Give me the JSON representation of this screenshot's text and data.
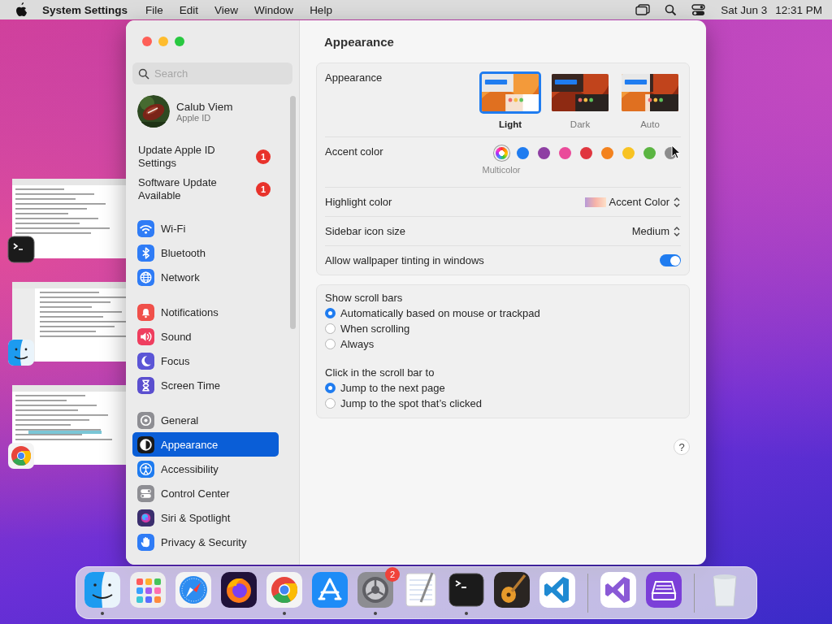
{
  "menu_bar": {
    "app_name": "System Settings",
    "menus": [
      "File",
      "Edit",
      "View",
      "Window",
      "Help"
    ],
    "date": "Sat Jun 3",
    "time": "12:31 PM"
  },
  "sidebar": {
    "search": {
      "placeholder": "Search"
    },
    "account": {
      "name": "Calub Viem",
      "subtitle": "Apple ID"
    },
    "alerts": [
      {
        "label": "Update Apple ID Settings",
        "badge": "1"
      },
      {
        "label": "Software Update Available",
        "badge": "1"
      }
    ],
    "groups": [
      {
        "items": [
          {
            "label": "Wi-Fi",
            "selected": false,
            "color": "#2f7cf6"
          },
          {
            "label": "Bluetooth",
            "selected": false,
            "color": "#2f7cf6"
          },
          {
            "label": "Network",
            "selected": false,
            "color": "#2f7cf6"
          }
        ]
      },
      {
        "items": [
          {
            "label": "Notifications",
            "selected": false,
            "color": "#f0504a"
          },
          {
            "label": "Sound",
            "selected": false,
            "color": "#ef3e5f"
          },
          {
            "label": "Focus",
            "selected": false,
            "color": "#5b55d6"
          },
          {
            "label": "Screen Time",
            "selected": false,
            "color": "#5b4fcf"
          }
        ]
      },
      {
        "items": [
          {
            "label": "General",
            "selected": false,
            "color": "#8e8e93"
          },
          {
            "label": "Appearance",
            "selected": true,
            "color": "#1a1a1a"
          },
          {
            "label": "Accessibility",
            "selected": false,
            "color": "#1f7cf0"
          },
          {
            "label": "Control Center",
            "selected": false,
            "color": "#8e8e93"
          },
          {
            "label": "Siri & Spotlight",
            "selected": false,
            "color": "#3b2f6e"
          },
          {
            "label": "Privacy & Security",
            "selected": false,
            "color": "#2f7cf6"
          }
        ]
      }
    ]
  },
  "content": {
    "title": "Appearance",
    "appearance": {
      "label": "Appearance",
      "options": [
        {
          "label": "Light",
          "kind": "light",
          "selected": true
        },
        {
          "label": "Dark",
          "kind": "dark",
          "selected": false
        },
        {
          "label": "Auto",
          "kind": "auto",
          "selected": false
        }
      ]
    },
    "accent": {
      "label": "Accent color",
      "caption": "Multicolor",
      "swatches": [
        {
          "kind": "multicolor",
          "selected": true
        },
        {
          "kind": "solid",
          "color": "#1f7cf0",
          "selected": false
        },
        {
          "kind": "solid",
          "color": "#8e3fa3",
          "selected": false
        },
        {
          "kind": "solid",
          "color": "#ea4b9a",
          "selected": false
        },
        {
          "kind": "solid",
          "color": "#e0363f",
          "selected": false
        },
        {
          "kind": "solid",
          "color": "#f3821e",
          "selected": false
        },
        {
          "kind": "solid",
          "color": "#f8c322",
          "selected": false
        },
        {
          "kind": "solid",
          "color": "#5bb542",
          "selected": false
        },
        {
          "kind": "solid",
          "color": "#8c8c8c",
          "selected": false
        }
      ]
    },
    "highlight": {
      "label": "Highlight color",
      "value": "Accent Color"
    },
    "icon_size": {
      "label": "Sidebar icon size",
      "value": "Medium"
    },
    "tinting": {
      "label": "Allow wallpaper tinting in windows",
      "on": true
    },
    "radio_groups": [
      {
        "title": "Show scroll bars",
        "options": [
          {
            "label": "Automatically based on mouse or trackpad",
            "selected": true
          },
          {
            "label": "When scrolling",
            "selected": false
          },
          {
            "label": "Always",
            "selected": false
          }
        ]
      },
      {
        "title": "Click in the scroll bar to",
        "options": [
          {
            "label": "Jump to the next page",
            "selected": true
          },
          {
            "label": "Jump to the spot that’s clicked",
            "selected": false
          }
        ]
      }
    ],
    "help": "?"
  },
  "dock": {
    "sections": [
      {
        "apps": [
          {
            "running": true
          },
          {
            "running": false
          },
          {
            "running": false
          },
          {
            "running": false
          },
          {
            "running": true
          },
          {
            "running": false
          },
          {
            "running": true,
            "badge": "2"
          },
          {
            "running": false
          },
          {
            "running": true
          },
          {
            "running": false
          },
          {
            "running": false
          }
        ]
      },
      {
        "apps": [
          {
            "running": false
          },
          {
            "running": false
          }
        ]
      },
      {
        "apps": [
          {
            "running": false
          }
        ]
      }
    ]
  }
}
